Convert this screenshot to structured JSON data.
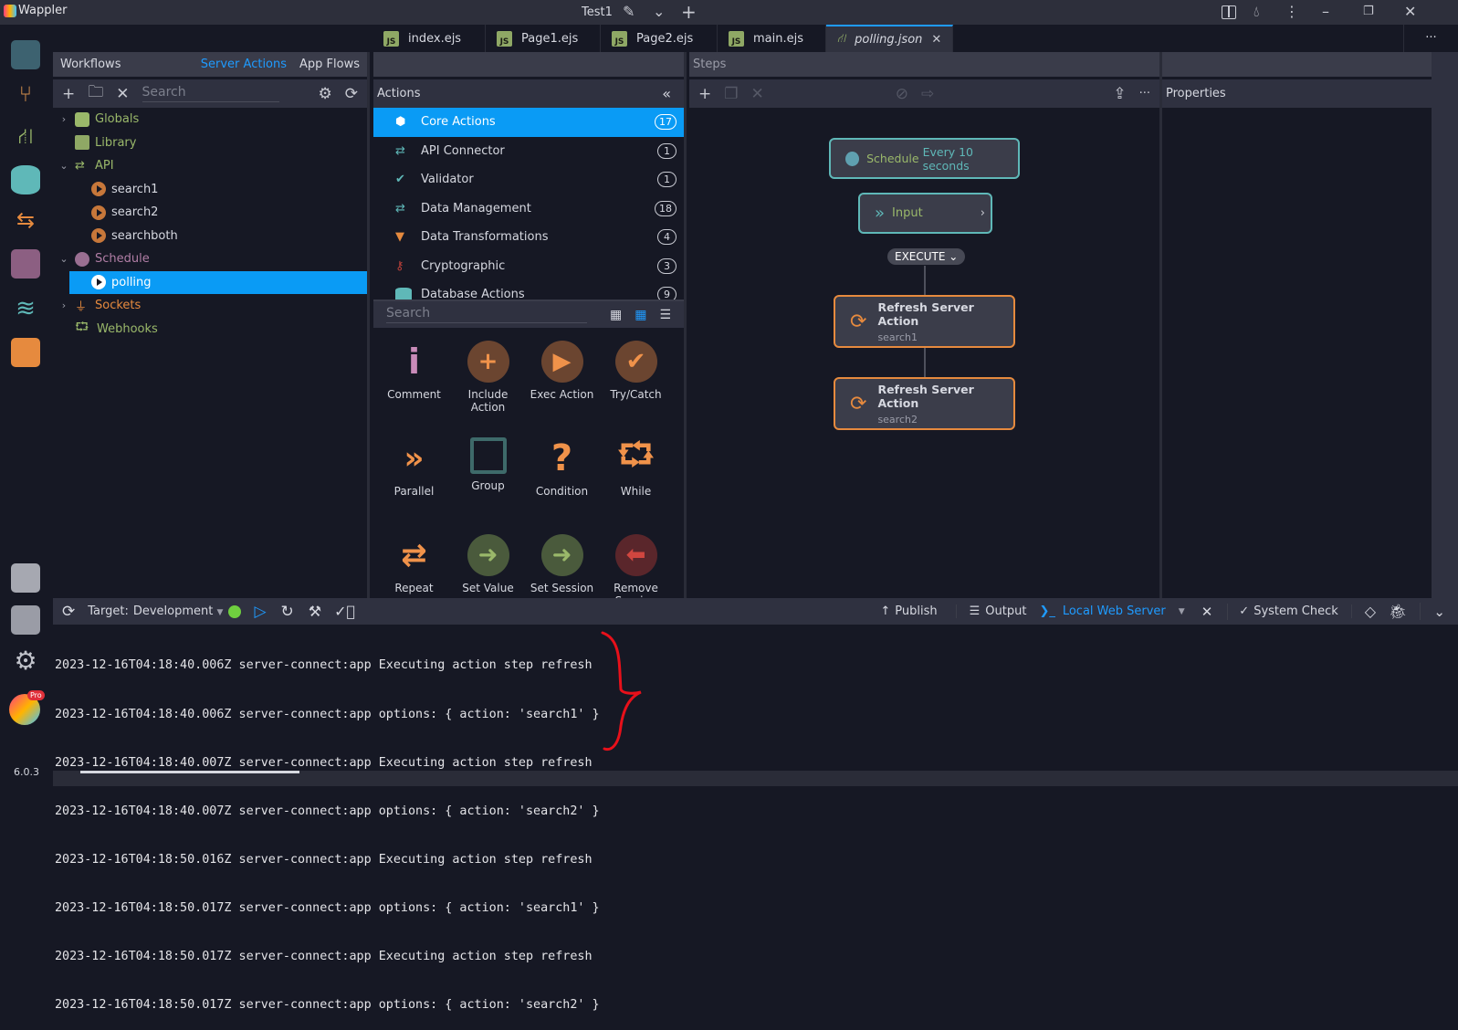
{
  "app": {
    "name": "Wappler",
    "project": "Test1",
    "version": "6.0.3",
    "pro_badge": "Pro"
  },
  "titlebar": {
    "icons": [
      "pencil-icon",
      "chevron-down-icon",
      "plus-icon",
      "split-view-icon",
      "theme-drop-icon",
      "more-vertical-icon",
      "minimize-icon",
      "restore-icon",
      "close-icon"
    ]
  },
  "colors": {
    "accent": "#0a9bf5",
    "schedule_border": "#5fb8b8",
    "step_border": "#e68a3e",
    "status_green": "#6fcf3f",
    "annotation": "#e8101a"
  },
  "workflows": {
    "title": "Workflows",
    "tabs": [
      {
        "label": "Server Actions",
        "active": true
      },
      {
        "label": "App Flows",
        "active": false
      }
    ],
    "search_placeholder": "Search",
    "tree": [
      {
        "label": "Globals",
        "icon": "cube-icon",
        "color": "#9ab86a",
        "expanded": false,
        "level": 0
      },
      {
        "label": "Library",
        "icon": "book-icon",
        "color": "#9ab86a",
        "level": 0
      },
      {
        "label": "API",
        "icon": "arrows-exchange-icon",
        "color": "#9ab86a",
        "expanded": true,
        "level": 0
      },
      {
        "label": "search1",
        "icon": "play-icon",
        "level": 1
      },
      {
        "label": "search2",
        "icon": "play-icon",
        "level": 1
      },
      {
        "label": "searchboth",
        "icon": "play-icon",
        "level": 1
      },
      {
        "label": "Schedule",
        "icon": "clock-icon",
        "color": "#b17ea6",
        "expanded": true,
        "level": 0
      },
      {
        "label": "polling",
        "icon": "play-icon",
        "level": 1,
        "selected": true
      },
      {
        "label": "Sockets",
        "icon": "plug-icon",
        "color": "#e68a3e",
        "expanded": false,
        "level": 0
      },
      {
        "label": "Webhooks",
        "icon": "webhook-icon",
        "color": "#9ab86a",
        "level": 0
      }
    ]
  },
  "tabs": [
    {
      "label": "index.ejs"
    },
    {
      "label": "Page1.ejs"
    },
    {
      "label": "Page2.ejs"
    },
    {
      "label": "main.ejs"
    },
    {
      "label": "polling.json",
      "active": true
    }
  ],
  "actions": {
    "title": "Actions",
    "search_placeholder": "Search",
    "categories": [
      {
        "label": "Core Actions",
        "count": "17",
        "icon": "cube-icon",
        "selected": true
      },
      {
        "label": "API Connector",
        "count": "1",
        "icon": "arrows-exchange-icon"
      },
      {
        "label": "Validator",
        "count": "1",
        "icon": "check-icon"
      },
      {
        "label": "Data Management",
        "count": "18",
        "icon": "arrows-exchange-icon"
      },
      {
        "label": "Data Transformations",
        "count": "4",
        "icon": "funnel-icon"
      },
      {
        "label": "Cryptographic",
        "count": "3",
        "icon": "key-icon"
      },
      {
        "label": "Database Actions",
        "count": "9",
        "icon": "database-icon"
      }
    ],
    "items": [
      {
        "label": "Comment",
        "icon": "info-icon"
      },
      {
        "label": "Include Action",
        "icon": "plus-circle-icon"
      },
      {
        "label": "Exec Action",
        "icon": "play-circle-icon"
      },
      {
        "label": "Try/Catch",
        "icon": "check-circle-icon"
      },
      {
        "label": "Parallel",
        "icon": "double-chevron-icon"
      },
      {
        "label": "Group",
        "icon": "group-icon"
      },
      {
        "label": "Condition",
        "icon": "question-icon"
      },
      {
        "label": "While",
        "icon": "while-loop-icon"
      },
      {
        "label": "Repeat",
        "icon": "repeat-icon"
      },
      {
        "label": "Set Value",
        "icon": "arrow-right-circle-icon"
      },
      {
        "label": "Set Session",
        "icon": "arrow-right-circle-icon"
      },
      {
        "label": "Remove Session",
        "icon": "arrow-left-circle-icon"
      }
    ]
  },
  "steps": {
    "title": "Steps",
    "trigger": {
      "label": "Schedule",
      "detail": "Every 10 seconds"
    },
    "input": {
      "label": "Input"
    },
    "execute": {
      "label": "EXECUTE"
    },
    "nodes": [
      {
        "title": "Refresh Server Action",
        "subtitle": "search1"
      },
      {
        "title": "Refresh Server Action",
        "subtitle": "search2"
      }
    ]
  },
  "properties": {
    "title": "Properties"
  },
  "bottombar": {
    "target_label": "Target:",
    "target_value": "Development",
    "publish": "Publish",
    "output": "Output",
    "server": "Local Web Server",
    "system_check": "System Check"
  },
  "console": {
    "lines": [
      "2023-12-16T04:18:40.006Z server-connect:app Executing action step refresh",
      "2023-12-16T04:18:40.006Z server-connect:app options: { action: 'search1' }",
      "2023-12-16T04:18:40.007Z server-connect:app Executing action step refresh",
      "2023-12-16T04:18:40.007Z server-connect:app options: { action: 'search2' }",
      "2023-12-16T04:18:50.016Z server-connect:app Executing action step refresh",
      "2023-12-16T04:18:50.017Z server-connect:app options: { action: 'search1' }",
      "2023-12-16T04:18:50.017Z server-connect:app Executing action step refresh",
      "2023-12-16T04:18:50.017Z server-connect:app options: { action: 'search2' }"
    ]
  }
}
